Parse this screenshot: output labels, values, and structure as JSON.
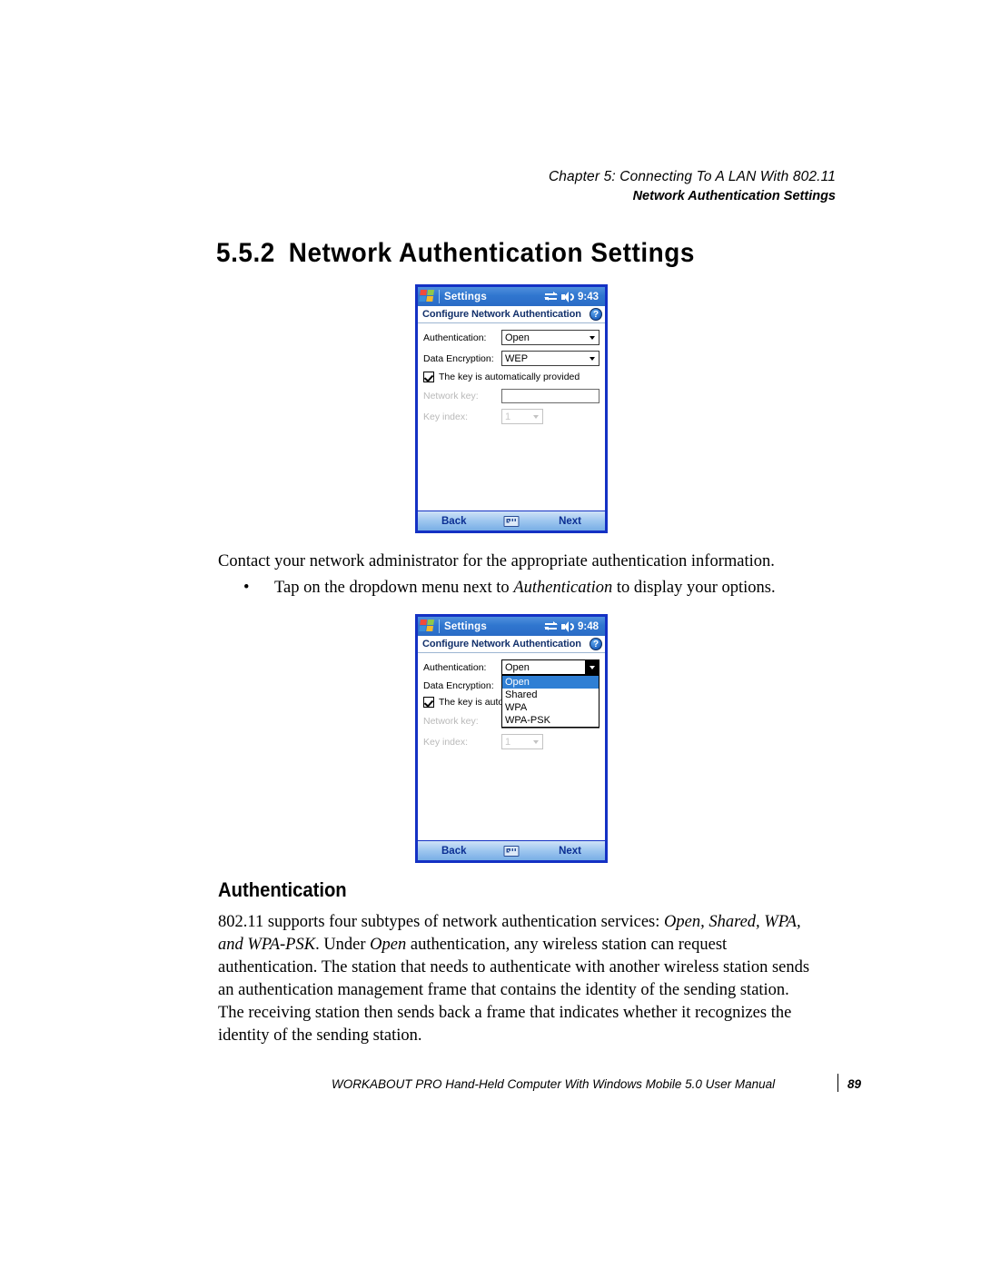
{
  "header": {
    "chapter_prefix": "Chapter",
    "chapter_number": "5:",
    "chapter_title": "Connecting To A LAN With 802.11",
    "chapter_line": "Chapter  5:  Connecting To A LAN With 802.11",
    "section_line": "Network Authentication Settings"
  },
  "section": {
    "number": "5.5.2",
    "title": "Network Authentication Settings"
  },
  "device_one": {
    "titlebar": {
      "app_title": "Settings",
      "time": "9:43",
      "start_icon": "windows-flag-icon",
      "connectivity_icon": "connectivity-arrows-icon",
      "volume_icon": "speaker-icon"
    },
    "subbar": {
      "title": "Configure Network Authentication",
      "help_label": "?"
    },
    "fields": {
      "authentication_label": "Authentication:",
      "authentication_value": "Open",
      "encryption_label": "Data Encryption:",
      "encryption_value": "WEP",
      "auto_key_label": "The key is automatically provided",
      "network_key_label": "Network key:",
      "network_key_value": "",
      "key_index_label": "Key index:",
      "key_index_value": "1"
    },
    "commandbar": {
      "back": "Back",
      "next": "Next",
      "keyboard_icon": "keyboard-icon"
    }
  },
  "device_two": {
    "titlebar": {
      "app_title": "Settings",
      "time": "9:48",
      "start_icon": "windows-flag-icon",
      "connectivity_icon": "connectivity-arrows-icon",
      "volume_icon": "speaker-icon"
    },
    "subbar": {
      "title": "Configure Network Authentication",
      "help_label": "?"
    },
    "fields": {
      "authentication_label": "Authentication:",
      "authentication_value": "Open",
      "encryption_label": "Data Encryption:",
      "auto_key_label": "The key is autom",
      "network_key_label": "Network key:",
      "key_index_label": "Key index:",
      "key_index_value": "1"
    },
    "dropdown": {
      "options": [
        "Open",
        "Shared",
        "WPA",
        "WPA-PSK"
      ],
      "selected": "Open"
    },
    "commandbar": {
      "back": "Back",
      "next": "Next",
      "keyboard_icon": "keyboard-icon"
    }
  },
  "body": {
    "contact_paragraph": "Contact your network administrator for the appropriate authentication information.",
    "bullet_marker": "•",
    "bullet_before": "Tap on the dropdown menu next to ",
    "bullet_italic": "Authentication",
    "bullet_after": " to display your options.",
    "sub_title": "Authentication",
    "auth_p1": "802.11 supports four subtypes of network authentication services: ",
    "auth_i1": "Open, Shared, WPA, and WPA-PSK",
    "auth_p2": ". Under ",
    "auth_i2": "Open",
    "auth_p3": " authentication, any wireless station can request authentication. The station that needs to authenticate with another wireless station sends an authentication management frame that contains the identity of the sending station. The receiving station then sends back a frame that indicates whether it recognizes the identity of the sending station."
  },
  "footer": {
    "manual_title": "WORKABOUT PRO Hand-Held Computer With Windows Mobile 5.0 User Manual",
    "page_number": "89"
  },
  "colors": {
    "titlebar_blue": "#3076cf",
    "device_border": "#1431c4",
    "subbar_text": "#12306b",
    "highlight_blue": "#2f7fd4",
    "command_text": "#0b2f93"
  }
}
